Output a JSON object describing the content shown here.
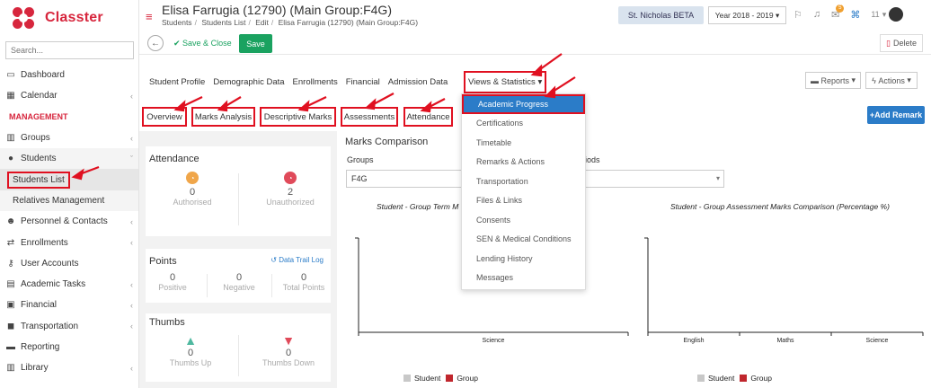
{
  "app": {
    "name": "Classter"
  },
  "sidebar": {
    "search_placeholder": "Search...",
    "items": [
      {
        "label": "Dashboard",
        "icon": "laptop-icon"
      },
      {
        "label": "Calendar",
        "icon": "calendar-icon"
      },
      {
        "label": "MANAGEMENT",
        "section": true
      },
      {
        "label": "Groups",
        "icon": "groups-icon"
      },
      {
        "label": "Students",
        "icon": "students-icon"
      },
      {
        "label": "Students List",
        "sub": true
      },
      {
        "label": "Relatives Management",
        "sub": true
      },
      {
        "label": "Personnel & Contacts",
        "icon": "personnel-icon"
      },
      {
        "label": "Enrollments",
        "icon": "enrollments-icon"
      },
      {
        "label": "User Accounts",
        "icon": "key-icon"
      },
      {
        "label": "Academic Tasks",
        "icon": "tasks-icon"
      },
      {
        "label": "Financial",
        "icon": "financial-icon"
      },
      {
        "label": "Transportation",
        "icon": "bus-icon"
      },
      {
        "label": "Reporting",
        "icon": "printer-icon"
      },
      {
        "label": "Library",
        "icon": "library-icon"
      }
    ]
  },
  "header": {
    "title": "Elisa Farrugia (12790) (Main Group:F4G)",
    "breadcrumb": [
      "Students",
      "Students List",
      "Edit",
      "Elisa Farrugia (12790) (Main Group:F4G)"
    ],
    "school": "St. Nicholas BETA",
    "year": "Year 2018 - 2019",
    "notification_count": "5",
    "user_count": "11"
  },
  "actions": {
    "back": "back",
    "save_close": "Save & Close",
    "save": "Save",
    "delete": "Delete"
  },
  "tabs": {
    "main": [
      "Student Profile",
      "Demographic Data",
      "Enrollments",
      "Financial",
      "Admission Data"
    ],
    "views": "Views & Statistics",
    "reports": "Reports",
    "actions": "Actions"
  },
  "subtabs": {
    "overview": "Overview",
    "marks_analysis": "Marks Analysis",
    "descriptive_marks": "Descriptive Marks",
    "assessments": "Assessments",
    "attendance": "Attendance",
    "add_remark": "Add Remark"
  },
  "dropdown": {
    "items": [
      "Academic Progress",
      "Certifications",
      "Timetable",
      "Remarks & Actions",
      "Transportation",
      "Files & Links",
      "Consents",
      "SEN & Medical Conditions",
      "Lending History",
      "Messages"
    ],
    "selected": "Academic Progress"
  },
  "attendance": {
    "title": "Attendance",
    "authorised_label": "Authorised",
    "authorised_value": "0",
    "unauthorized_label": "Unauthorized",
    "unauthorized_value": "2"
  },
  "points": {
    "title": "Points",
    "data_trail": "Data Trail Log",
    "positive_label": "Positive",
    "positive_value": "0",
    "negative_label": "Negative",
    "negative_value": "0",
    "total_label": "Total Points",
    "total_value": "0"
  },
  "thumbs": {
    "title": "Thumbs",
    "up_label": "Thumbs Up",
    "up_value": "0",
    "down_label": "Thumbs Down",
    "down_value": "0"
  },
  "marks": {
    "title": "Marks Comparison",
    "groups_label": "Groups",
    "group_value": "F4G",
    "periods_label": "riods",
    "chart1_title": "Student - Group Term M",
    "chart2_title": "Student - Group Assessment Marks Comparison (Percentage %)"
  },
  "chart_data": [
    {
      "type": "bar",
      "title": "Student - Group Term M",
      "categories": [
        "Science"
      ],
      "series": [
        {
          "name": "Student",
          "values": [
            null
          ],
          "color": "#c8c8c8"
        },
        {
          "name": "Group",
          "values": [
            null
          ],
          "color": "#c0262d"
        }
      ]
    },
    {
      "type": "bar",
      "title": "Student - Group Assessment Marks Comparison (Percentage %)",
      "categories": [
        "English",
        "Maths",
        "Science"
      ],
      "series": [
        {
          "name": "Student",
          "values": [
            null,
            null,
            null
          ],
          "color": "#c8c8c8"
        },
        {
          "name": "Group",
          "values": [
            null,
            null,
            null
          ],
          "color": "#c0262d"
        }
      ]
    }
  ],
  "colors": {
    "brand": "#d7263d",
    "primary": "#2b7cc8",
    "success": "#1aa260",
    "annotation": "#e01020"
  }
}
